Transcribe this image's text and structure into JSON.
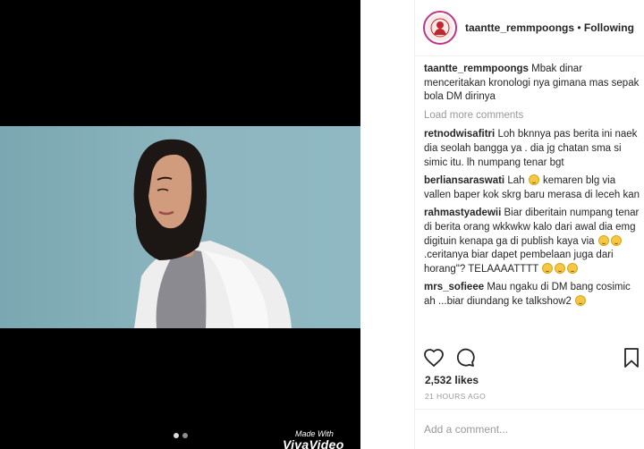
{
  "media": {
    "watermark_top": "Made With",
    "watermark_bottom": "VivaVideo",
    "carousel_count": 2,
    "carousel_active": 0
  },
  "header": {
    "username": "taantte_remmpoongs",
    "separator": "•",
    "follow_state": "Following"
  },
  "caption": {
    "user": "taantte_remmpoongs",
    "text": "Mbak dinar menceritakan kronologi nya gimana mas sepak bola DM dirinya"
  },
  "load_more": "Load more comments",
  "comments": [
    {
      "user": "retnodwisafitri",
      "text": "Loh bknnya pas berita ini naek dia seolah bangga ya . dia jg chatan sma si simic itu. lh numpang tenar bgt"
    },
    {
      "user": "berliansaraswati",
      "text_a": "Lah",
      "text_b": "kemaren blg via vallen baper kok skrg baru merasa di leceh kan"
    },
    {
      "user": "rahmastyadewii",
      "text_a": "Biar diberitain numpang tenar di berita orang wkkwkw kalo dari awal dia emg digituin kenapa ga di publish kaya via",
      "text_b": ".ceritanya biar dapet pembelaan juga dari horang\"? TELAAAATTTT"
    },
    {
      "user": "mrs_sofieee",
      "text": "Mau ngaku di DM bang cosimic ah ...biar diundang ke talkshow2"
    }
  ],
  "icons": [
    "heart-icon",
    "comment-icon",
    "bookmark-icon",
    "smile-emoji-icon"
  ],
  "likes": "2,532 likes",
  "timestamp": "21 HOURS AGO",
  "add_comment_placeholder": "Add a comment...",
  "colors": {
    "avatar_ring": "#c13584",
    "photo_bg": "#8db6c0",
    "muted": "#999999"
  }
}
